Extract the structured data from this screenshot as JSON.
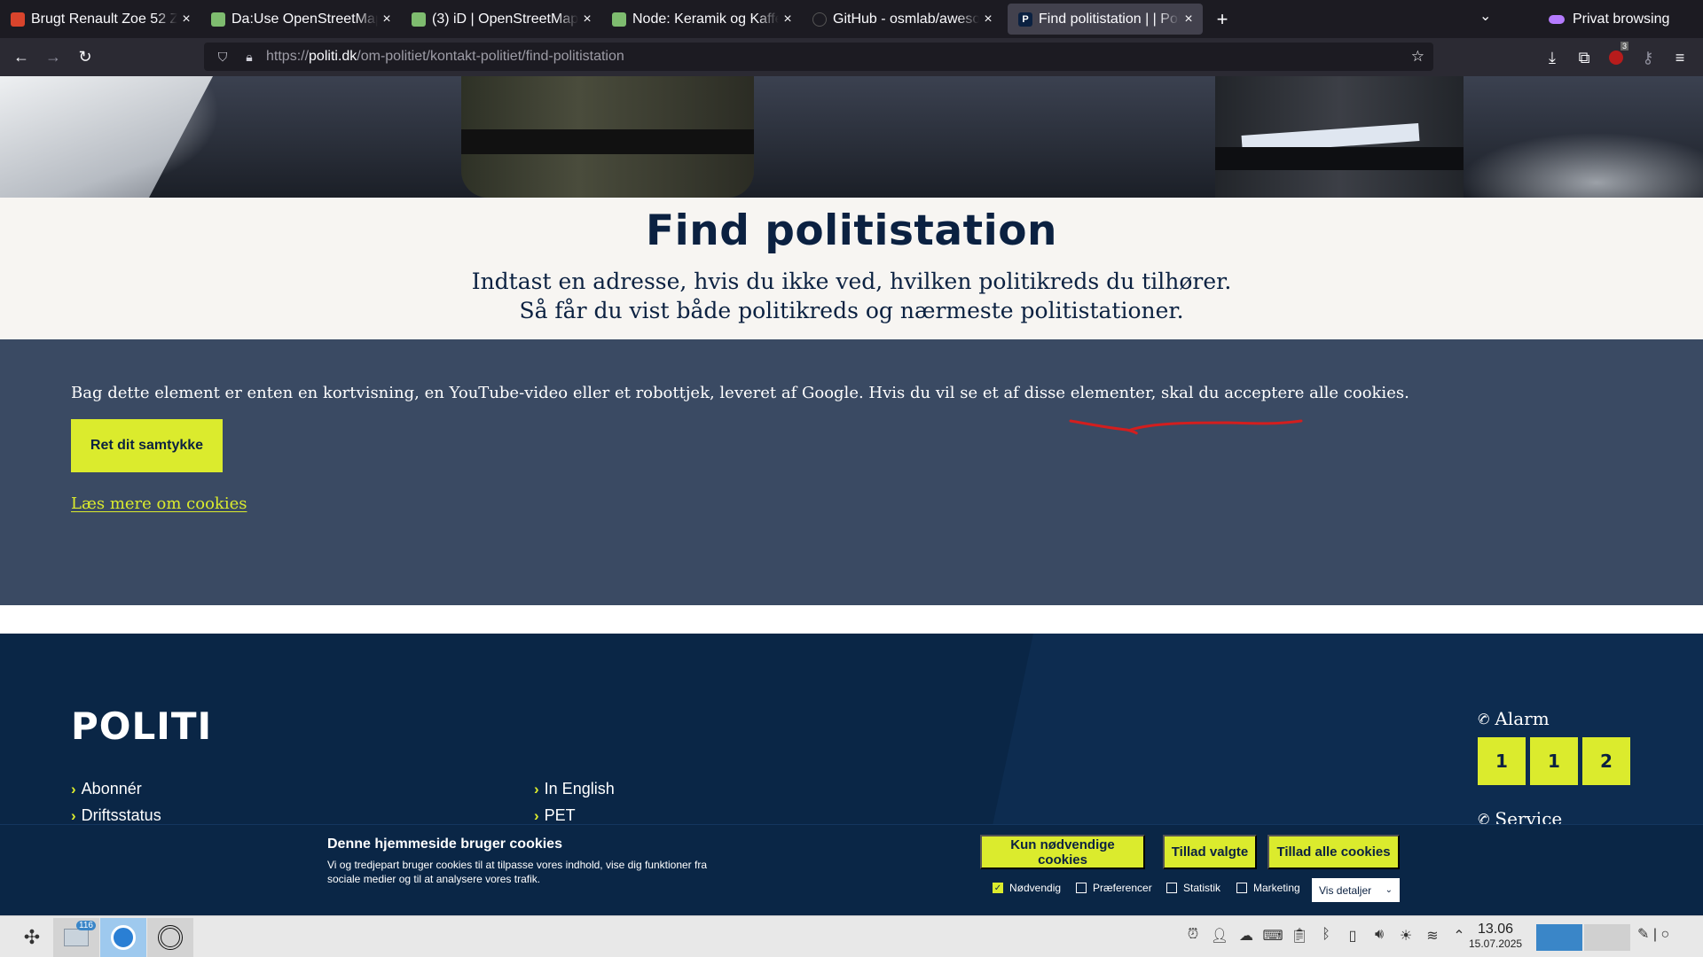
{
  "browser": {
    "tabs": [
      {
        "title": "Brugt Renault Zoe 52 Z",
        "favicon_color": "#d9442c"
      },
      {
        "title": "Da:Use OpenStreetMap",
        "favicon_color": "#7ebc6f"
      },
      {
        "title": "(3) iD | OpenStreetMap",
        "favicon_color": "#7ebc6f"
      },
      {
        "title": "Node: Keramik og Kaffe",
        "favicon_color": "#7ebc6f"
      },
      {
        "title": "GitHub - osmlab/aweso",
        "favicon_color": "#1c1b22"
      },
      {
        "title": "Find politistation | | Poli",
        "favicon_color": "#0b2141",
        "active": true
      }
    ],
    "new_tab_symbol": "+",
    "private_label": "Privat browsing",
    "url": {
      "scheme": "https://",
      "host": "politi.dk",
      "path": "/om-politiet/kontakt-politiet/find-politistation"
    },
    "extension_badge": "3"
  },
  "page": {
    "title": "Find politistation",
    "intro": "Indtast en adresse, hvis du ikke ved, hvilken politikreds du tilhører. Så får du vist både politikreds og nærmeste politistationer.",
    "consent_block": {
      "text": "Bag dette element er enten en kortvisning, en YouTube-video eller et robottjek, leveret af Google. Hvis du vil se et af disse elementer, skal du acceptere alle cookies.",
      "button": "Ret dit samtykke",
      "link": "Læs mere om cookies"
    },
    "footer": {
      "logo": "POLITI",
      "links_col1": [
        "Abonnér",
        "Driftsstatus"
      ],
      "links_col2": [
        "In English",
        "PET"
      ],
      "alarm_label": "Alarm",
      "alarm_digits": [
        "1",
        "1",
        "2"
      ],
      "service_label": "Service"
    }
  },
  "cookie_bar": {
    "title": "Denne hjemmeside bruger cookies",
    "description": "Vi og tredjepart bruger cookies til at tilpasse vores indhold, vise dig funktioner fra sociale medier og til at analysere vores trafik.",
    "buttons": [
      "Kun nødvendige cookies",
      "Tillad valgte",
      "Tillad alle cookies"
    ],
    "checkboxes": [
      {
        "label": "Nødvendig",
        "checked": true
      },
      {
        "label": "Præferencer",
        "checked": false
      },
      {
        "label": "Statistik",
        "checked": false
      },
      {
        "label": "Marketing",
        "checked": false
      }
    ],
    "details": "Vis detaljer"
  },
  "taskbar": {
    "mail_badge": "116",
    "time": "13.06",
    "date": "15.07.2025"
  },
  "colors": {
    "police_navy": "#0b2141",
    "consent_bg": "#3a4a63",
    "accent_yellow": "#dbeb2d",
    "footer_bg": "#0a2646"
  }
}
